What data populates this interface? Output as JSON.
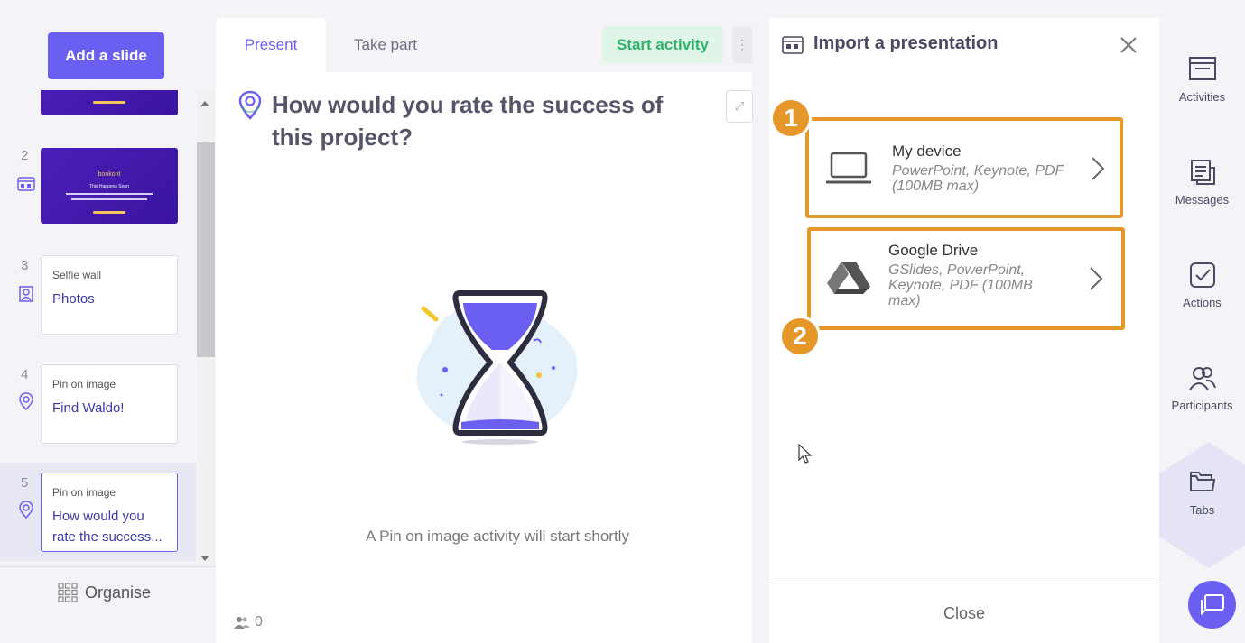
{
  "left_panel": {
    "add_slide_label": "Add a slide",
    "organise_label": "Organise",
    "slides": [
      {
        "num": "",
        "thumb": "purple"
      },
      {
        "num": "2",
        "thumb": "purple",
        "thumb_brand": "bonkont",
        "thumb_line": "This Happens Soon"
      },
      {
        "num": "3",
        "type": "Selfie wall",
        "title": "Photos"
      },
      {
        "num": "4",
        "type": "Pin on image",
        "title": "Find Waldo!"
      },
      {
        "num": "5",
        "type": "Pin on image",
        "title": "How would you rate the success..."
      }
    ]
  },
  "center": {
    "tabs": [
      "Present",
      "Take part"
    ],
    "start_label": "Start activity",
    "more_label": "⋮",
    "question": "How would you rate the success of this project?",
    "waiting_text": "A Pin on image activity will start shortly",
    "participant_count": "0"
  },
  "import_panel": {
    "title": "Import a presentation",
    "options": [
      {
        "badge": "1",
        "title": "My device",
        "desc": "PowerPoint, Keynote, PDF (100MB max)"
      },
      {
        "badge": "2",
        "title": "Google Drive",
        "desc": "GSlides, PowerPoint, Keynote, PDF (100MB max)"
      }
    ],
    "close_label": "Close"
  },
  "right_bar": {
    "items": [
      {
        "label": "Activities"
      },
      {
        "label": "Messages"
      },
      {
        "label": "Actions"
      },
      {
        "label": "Participants"
      },
      {
        "label": "Tabs"
      }
    ]
  },
  "colors": {
    "accent": "#6b5ff2",
    "highlight": "#e5972a",
    "start_bg": "#dff5e7",
    "start_text": "#2fb36b"
  }
}
